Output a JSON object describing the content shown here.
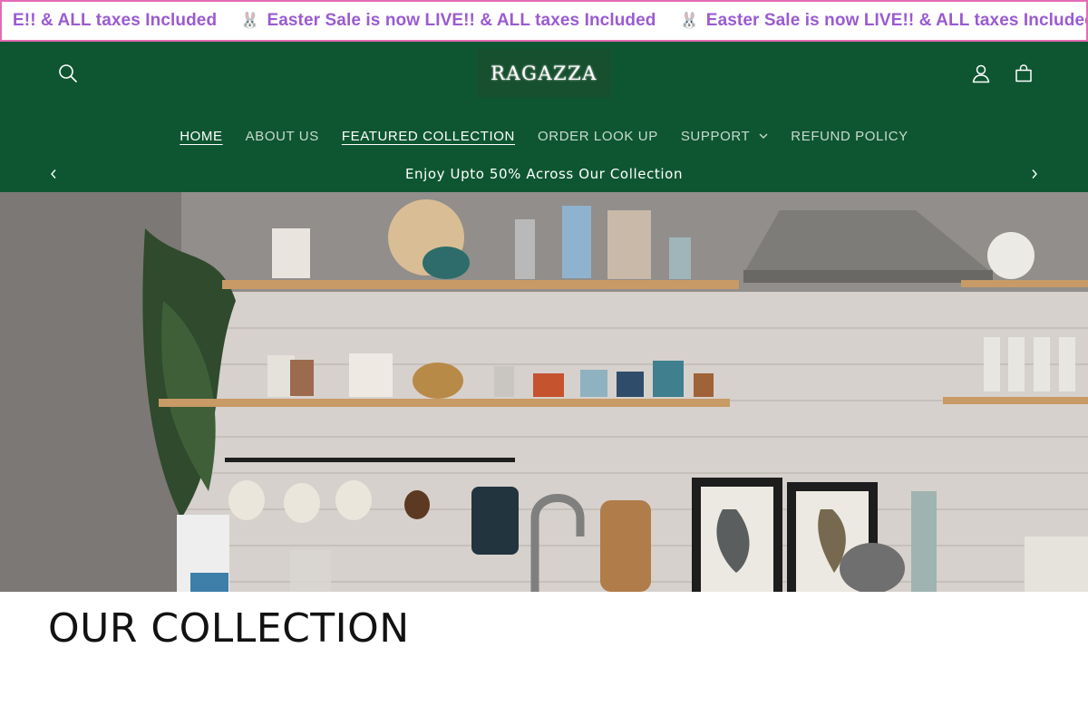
{
  "marquee": {
    "items": [
      "E!! & ALL taxes Included",
      "Easter Sale is now LIVE!! & ALL taxes Included",
      "Easter Sale is now LIVE!! & ALL taxes Included"
    ],
    "border_color": "#e46bb4",
    "text_color": "#9a5bd1"
  },
  "header": {
    "background": "#0e5631",
    "logo_text": "RAGAZZA",
    "search_icon": "search-icon",
    "account_icon": "account-icon",
    "cart_icon": "cart-icon"
  },
  "nav": {
    "items": [
      {
        "label": "HOME"
      },
      {
        "label": "ABOUT US"
      },
      {
        "label": "FEATURED COLLECTION"
      },
      {
        "label": "ORDER LOOK UP"
      },
      {
        "label": "SUPPORT"
      },
      {
        "label": "REFUND POLICY"
      }
    ]
  },
  "announcement": {
    "text": "Enjoy Upto 50% Across Our Collection",
    "prev_icon": "chevron-left-icon",
    "next_icon": "chevron-right-icon"
  },
  "hero": {
    "image": "kitchen-shelves-photo"
  },
  "section": {
    "title": "OUR COLLECTION"
  }
}
